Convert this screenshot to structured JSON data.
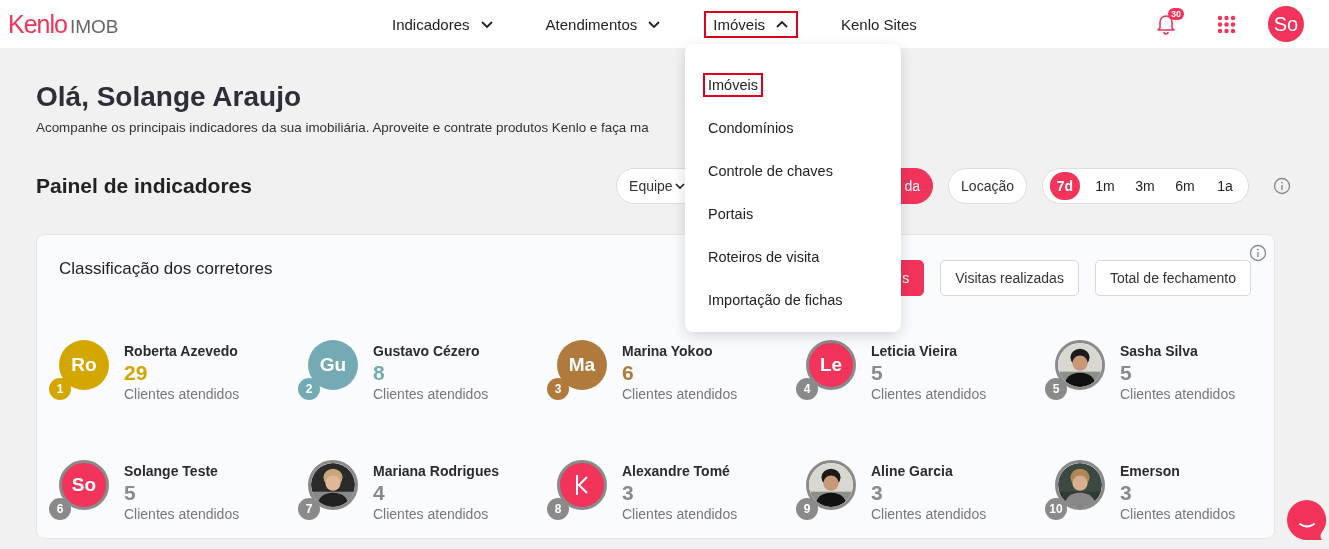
{
  "header": {
    "brand": {
      "name": "Kenlo",
      "product": "IMOB"
    },
    "nav": [
      {
        "label": "Indicadores",
        "kind": "menu",
        "expanded": false,
        "selected": false
      },
      {
        "label": "Atendimentos",
        "kind": "menu",
        "expanded": false,
        "selected": false
      },
      {
        "label": "Imóveis",
        "kind": "menu",
        "expanded": true,
        "selected": true
      },
      {
        "label": "Kenlo Sites",
        "kind": "link",
        "selected": false
      }
    ],
    "notifications": "30",
    "user_initials": "So"
  },
  "nav_menu": {
    "items": [
      {
        "label": "Imóveis",
        "selected": true
      },
      {
        "label": "Condomínios",
        "selected": false
      },
      {
        "label": "Controle de chaves",
        "selected": false
      },
      {
        "label": "Portais",
        "selected": false
      },
      {
        "label": "Roteiros de visita",
        "selected": false
      },
      {
        "label": "Importação de fichas",
        "selected": false
      }
    ]
  },
  "greeting": {
    "title": "Olá, Solange Araujo",
    "subtitle": "Acompanhe os principais indicadores da sua imobiliária. Aproveite e contrate produtos Kenlo e faça ma"
  },
  "panel": {
    "title": "Painel de indicadores",
    "team_filter": "Equipe",
    "business_filters": [
      {
        "label": "da",
        "selected": true
      },
      {
        "label": "Locação",
        "selected": false
      }
    ],
    "periods": [
      {
        "label": "7d",
        "selected": true
      },
      {
        "label": "1m",
        "selected": false
      },
      {
        "label": "3m",
        "selected": false
      },
      {
        "label": "6m",
        "selected": false
      },
      {
        "label": "1a",
        "selected": false
      }
    ]
  },
  "ranking": {
    "title": "Classificação dos corretores",
    "metrics": [
      {
        "label": "s",
        "selected": true
      },
      {
        "label": "Visitas realizadas",
        "selected": false
      },
      {
        "label": "Total de fechamento",
        "selected": false
      }
    ],
    "agents": [
      {
        "rank": "1",
        "name": "Roberta Azevedo",
        "count": "29",
        "caption": "Clientes atendidos",
        "color": "#d4a600",
        "avatar": {
          "kind": "initials",
          "text": "Ro",
          "color": "#d4a600"
        }
      },
      {
        "rank": "2",
        "name": "Gustavo Cézero",
        "count": "8",
        "caption": "Clientes atendidos",
        "color": "#74aab4",
        "avatar": {
          "kind": "initials",
          "text": "Gu",
          "color": "#74aab4"
        }
      },
      {
        "rank": "3",
        "name": "Marina Yokoo",
        "count": "6",
        "caption": "Clientes atendidos",
        "color": "#b07a3c",
        "avatar": {
          "kind": "initials",
          "text": "Ma",
          "color": "#b07a3c"
        }
      },
      {
        "rank": "4",
        "name": "Leticia Vieira",
        "count": "5",
        "caption": "Clientes atendidos",
        "color": "#8a8a8a",
        "avatar": {
          "kind": "initials",
          "text": "Le",
          "color": "#f2335a"
        }
      },
      {
        "rank": "5",
        "name": "Sasha Silva",
        "count": "5",
        "caption": "Clientes atendidos",
        "color": "#8a8a8a"
      },
      {
        "rank": "6",
        "name": "Solange Teste",
        "count": "5",
        "caption": "Clientes atendidos",
        "color": "#8a8a8a",
        "avatar": {
          "kind": "initials",
          "text": "So",
          "color": "#f2335a"
        }
      },
      {
        "rank": "7",
        "name": "Mariana Rodrigues",
        "count": "4",
        "caption": "Clientes atendidos",
        "color": "#8a8a8a"
      },
      {
        "rank": "8",
        "name": "Alexandre Tomé",
        "count": "3",
        "caption": "Clientes atendidos",
        "color": "#8a8a8a",
        "avatar": {
          "kind": "logo",
          "color": "#f2335a"
        }
      },
      {
        "rank": "9",
        "name": "Aline Garcia",
        "count": "3",
        "caption": "Clientes atendidos",
        "color": "#8a8a8a"
      },
      {
        "rank": "10",
        "name": "Emerson",
        "count": "3",
        "caption": "Clientes atendidos",
        "color": "#8a8a8a"
      }
    ]
  }
}
